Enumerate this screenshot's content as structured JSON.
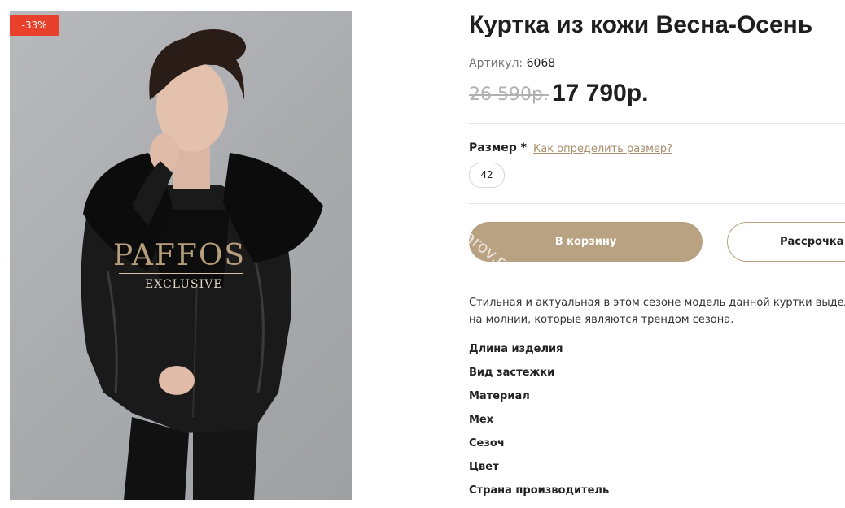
{
  "product": {
    "discount_badge": "-33%",
    "watermark": {
      "brand": "PAFFOS",
      "sub": "EXCLUSIVE"
    },
    "title": "Куртка из кожи Весна-Осень",
    "sku_label": "Артикул:",
    "sku_value": "6068",
    "old_price": "26 590р.",
    "new_price": "17 790р."
  },
  "size": {
    "label": "Размер *",
    "help_link": "Как определить размер?",
    "options": [
      "42"
    ]
  },
  "actions": {
    "add_to_cart": "В корзину",
    "cart_watermark": "arov.ru",
    "installment": "Рассрочка н"
  },
  "description": {
    "line1": "Стильная и актуальная в этом сезоне модель данной куртки выделяется",
    "line2": "на молнии, которые являются трендом сезона."
  },
  "specs": [
    "Длина изделия",
    "Вид застежки",
    "Материал",
    "Мех",
    "Сезоч",
    "Цвет",
    "Страна производитель"
  ],
  "colors": {
    "accent": "#b9a282",
    "badge": "#e8402a",
    "link": "#a98e6c"
  }
}
